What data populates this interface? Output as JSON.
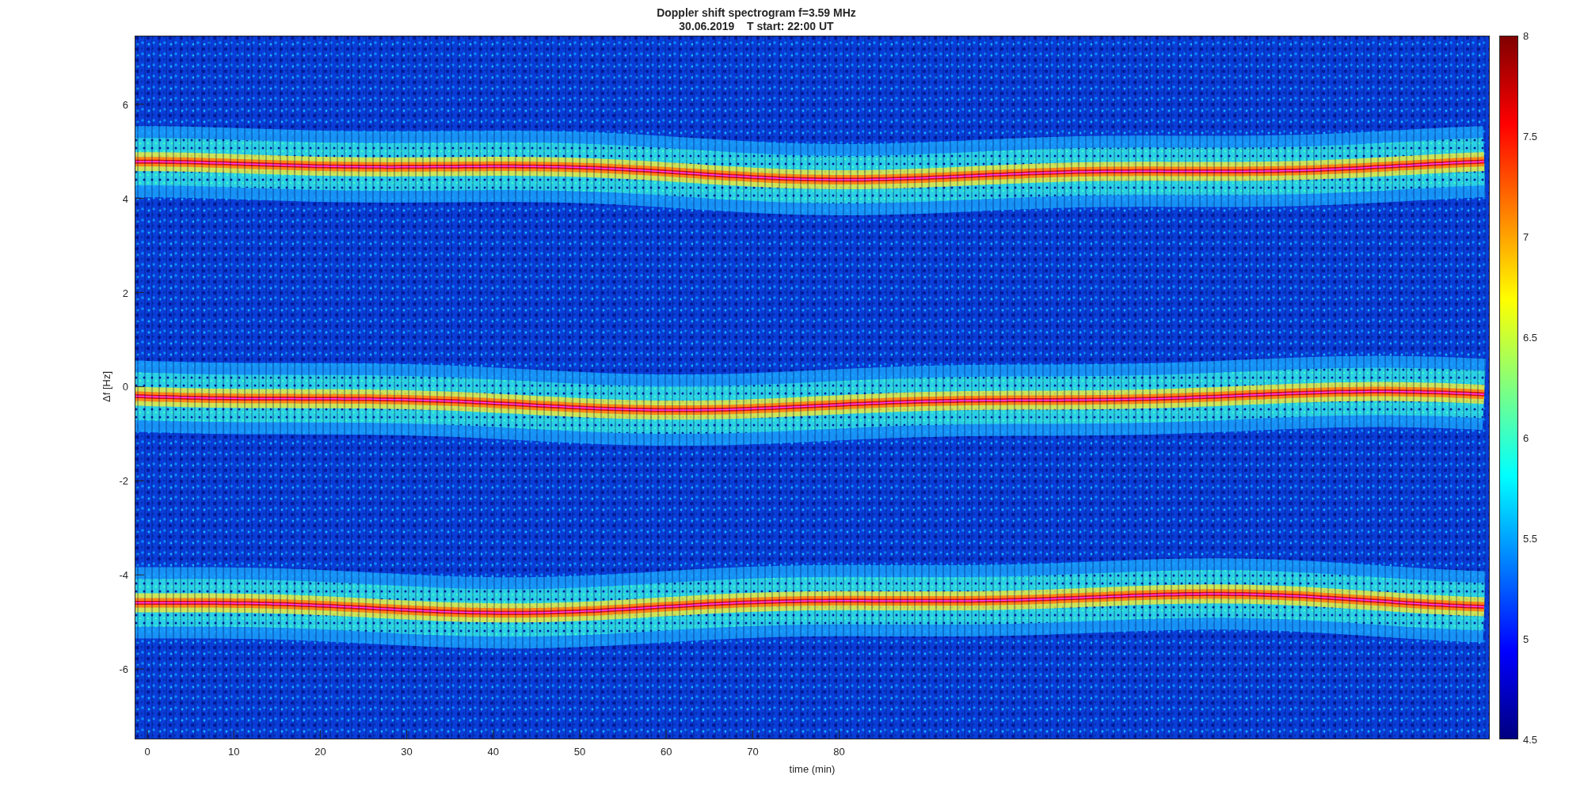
{
  "figure": {
    "title": "Doppler shift spectrogram f=3.59 MHz",
    "subtitle": "30.06.2019    T start: 22:00 UT"
  },
  "axes": {
    "xlabel": "time (min)",
    "ylabel": "Δf [Hz]",
    "xticks": [
      "0",
      "10",
      "20",
      "30",
      "40",
      "50",
      "60",
      "70",
      "80"
    ],
    "yticks": [
      "6",
      "4",
      "2",
      "0",
      "-2",
      "-4",
      "-6"
    ]
  },
  "colorbar": {
    "ticks": [
      "8",
      "7.5",
      "7",
      "6.5",
      "6",
      "5.5",
      "5",
      "4.5"
    ]
  }
}
